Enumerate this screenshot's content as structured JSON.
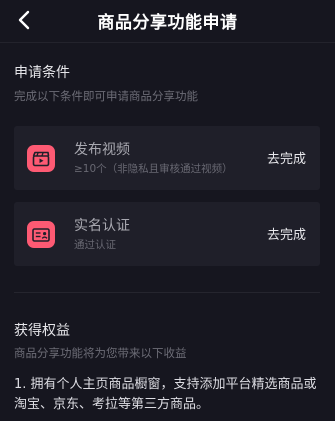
{
  "header": {
    "title": "商品分享功能申请",
    "back_icon": "chevron-left-icon"
  },
  "conditions": {
    "title": "申请条件",
    "subtitle": "完成以下条件即可申请商品分享功能",
    "items": [
      {
        "icon": "video-clapper-icon",
        "title": "发布视频",
        "subtitle": "≥10个（非隐私且审核通过视频）",
        "action": "去完成"
      },
      {
        "icon": "id-card-icon",
        "title": "实名认证",
        "subtitle": "通过认证",
        "action": "去完成"
      }
    ]
  },
  "benefits": {
    "title": "获得权益",
    "subtitle": "商品分享功能将为您带来以下收益",
    "items": [
      {
        "line1": "1. 拥有个人主页商品橱窗，支持添加平台精选商品或",
        "line2": "淘宝、京东、考拉等第三方商品。"
      }
    ]
  },
  "colors": {
    "background": "#16161f",
    "card": "#1f1f29",
    "icon_accent": "#fd5a73",
    "primary_text": "#ffffff",
    "secondary_text": "#6c6c76"
  }
}
